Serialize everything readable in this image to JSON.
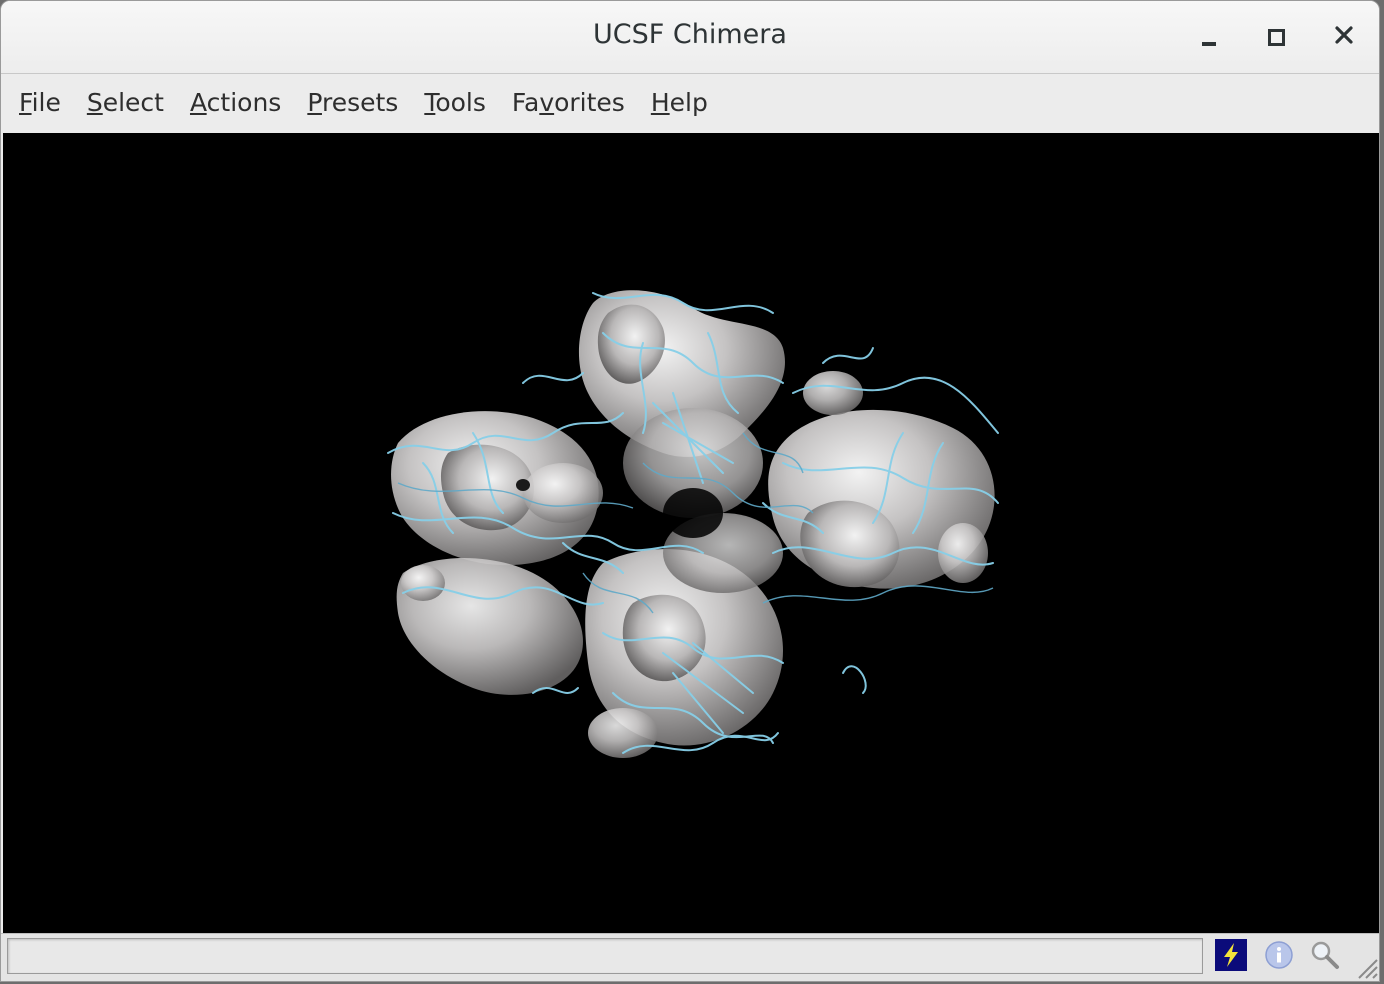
{
  "window": {
    "title": "UCSF Chimera",
    "controls": {
      "minimize": "minimize-icon",
      "maximize": "maximize-icon",
      "close": "close-icon"
    }
  },
  "menu": [
    {
      "mnemonic": "F",
      "rest": "ile"
    },
    {
      "mnemonic": "S",
      "rest": "elect"
    },
    {
      "mnemonic": "A",
      "rest": "ctions"
    },
    {
      "mnemonic": "P",
      "rest": "resets"
    },
    {
      "mnemonic": "T",
      "rest": "ools"
    },
    {
      "pre": "Fa",
      "mnemonic": "v",
      "rest": "orites"
    },
    {
      "mnemonic": "H",
      "rest": "elp"
    }
  ],
  "viewport": {
    "background": "#000000",
    "surface_color": "#c8c6c6",
    "ribbon_color": "#87cfe8"
  },
  "status": {
    "message": "",
    "icons": [
      "command-line-icon",
      "info-icon",
      "magnifier-icon"
    ]
  }
}
